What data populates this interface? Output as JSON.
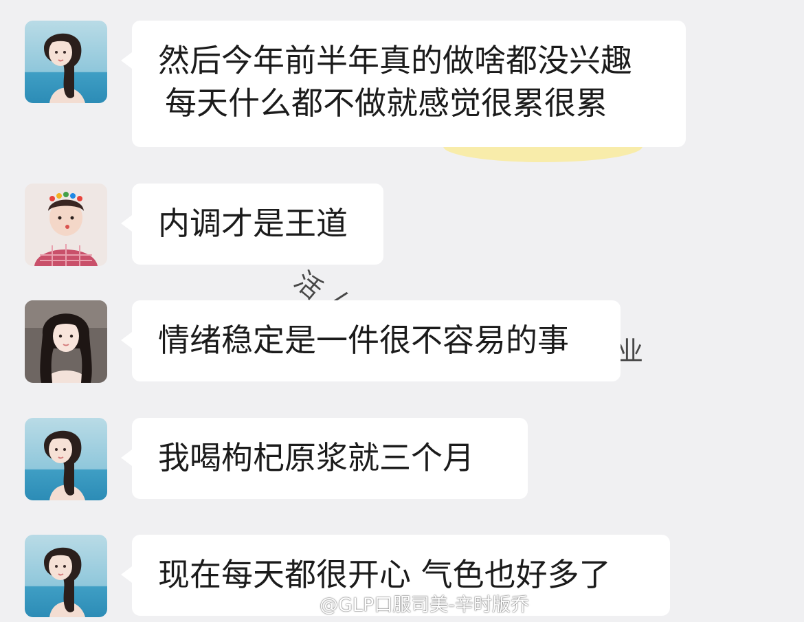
{
  "messages": [
    {
      "sender": "girl-braid",
      "lines": [
        "然后今年前半年真的做啥都没兴趣",
        "每天什么都不做就感觉很累很累"
      ]
    },
    {
      "sender": "baby",
      "lines": [
        "内调才是王道"
      ]
    },
    {
      "sender": "girl-longhair",
      "lines": [
        "情绪稳定是一件很不容易的事"
      ]
    },
    {
      "sender": "girl-braid",
      "lines": [
        "我喝枸杞原浆就三个月"
      ]
    },
    {
      "sender": "girl-braid",
      "lines": [
        "现在每天都很开心 气色也好多了"
      ]
    }
  ],
  "background_text": [
    "活",
    "/",
    "业"
  ],
  "watermark": "@GLP口服司美-辛时版乔",
  "colors": {
    "background": "#f0f0f2",
    "bubble": "#ffffff",
    "text": "#1b1b1b",
    "accent_yellow": "#f8ecaa"
  }
}
